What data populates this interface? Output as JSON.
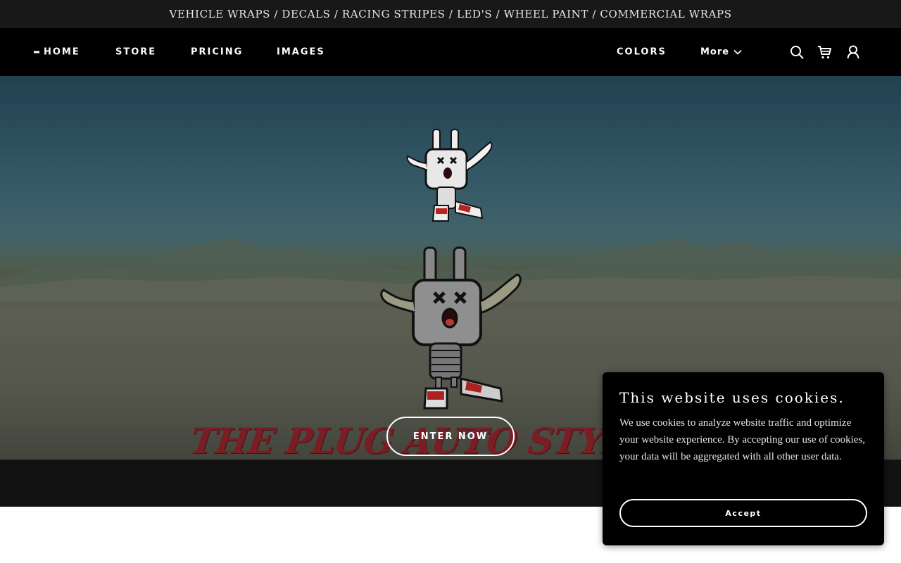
{
  "announcement": {
    "text": "VEHICLE WRAPS / DECALS / RACING STRIPES / LED'S / WHEEL PAINT / COMMERCIAL WRAPS"
  },
  "nav": {
    "items": [
      {
        "label": "HOME",
        "active": true
      },
      {
        "label": "STORE"
      },
      {
        "label": "PRICING"
      },
      {
        "label": "IMAGES"
      },
      {
        "label": "COLORS"
      }
    ],
    "more_label": "More",
    "icons": [
      "search-icon",
      "cart-icon",
      "user-icon"
    ]
  },
  "hero": {
    "brand_title": "THE PLUG AUTO STYLING",
    "cta_label": "ENTER NOW"
  },
  "cookie_banner": {
    "title": "This website uses cookies.",
    "body": "We use cookies to analyze website traffic and optimize your website experience. By accepting our use of cookies, your data will be aggregated with all other user data.",
    "accept_label": "Accept"
  },
  "colors": {
    "announcement_bg": "#181818",
    "header_bg": "#000000",
    "brand_red": "#7a1d24",
    "cookie_bg": "#000000"
  }
}
